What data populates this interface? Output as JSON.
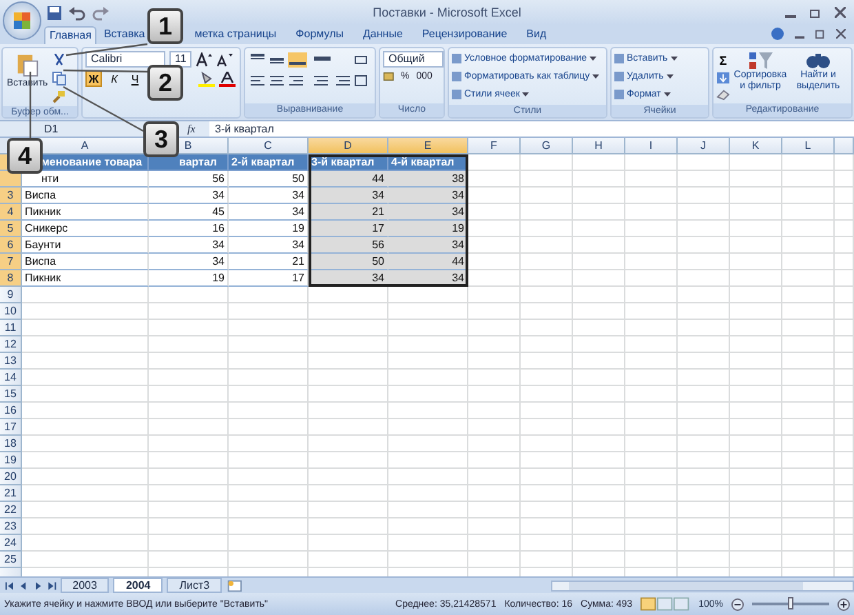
{
  "window": {
    "title": "Поставки - Microsoft Excel"
  },
  "tabs": [
    {
      "label": "Главная",
      "selected": true
    },
    {
      "label": "Вставка",
      "selected": false
    },
    {
      "label": "метка страницы",
      "selected": false
    },
    {
      "label": "Формулы",
      "selected": false
    },
    {
      "label": "Данные",
      "selected": false
    },
    {
      "label": "Рецензирование",
      "selected": false
    },
    {
      "label": "Вид",
      "selected": false
    }
  ],
  "ribbon": {
    "clipboard": {
      "paste": "Вставить",
      "label": "Буфер обм..."
    },
    "font": {
      "name": "Calibri",
      "size": "11",
      "bold": "Ж",
      "italic": "К",
      "underline": "Ч"
    },
    "alignment": {
      "label": "Выравнивание"
    },
    "number": {
      "format": "Общий",
      "percent": "%",
      "thousands": "000",
      "label": "Число"
    },
    "styles": {
      "items": [
        "Условное форматирование",
        "Форматировать как таблицу",
        "Стили ячеек"
      ],
      "label": "Стили"
    },
    "cells": {
      "items": [
        "Вставить",
        "Удалить",
        "Формат"
      ],
      "label": "Ячейки"
    },
    "editing": {
      "sum": "Σ",
      "sort": "Сортировка и фильтр",
      "find": "Найти и выделить",
      "label": "Редактирование"
    }
  },
  "formula_bar": {
    "name_box": "D1",
    "function": "fx",
    "value": "3-й квартал"
  },
  "columns": [
    {
      "label": "A",
      "selected": false
    },
    {
      "label": "B",
      "selected": false
    },
    {
      "label": "C",
      "selected": false
    },
    {
      "label": "D",
      "selected": true
    },
    {
      "label": "E",
      "selected": true
    },
    {
      "label": "F",
      "selected": false
    },
    {
      "label": "G",
      "selected": false
    },
    {
      "label": "H",
      "selected": false
    },
    {
      "label": "I",
      "selected": false
    },
    {
      "label": "J",
      "selected": false
    },
    {
      "label": "K",
      "selected": false
    },
    {
      "label": "L",
      "selected": false
    }
  ],
  "rows": [
    {
      "kind": "header",
      "selected": true,
      "cells": [
        "менование товара",
        "вартал",
        "2-й квартал",
        "3-й квартал",
        "4-й квартал"
      ]
    },
    {
      "kind": "data",
      "selected": true,
      "cells": [
        "нти",
        "56",
        "50",
        "44",
        "38"
      ]
    },
    {
      "kind": "data",
      "num": "3",
      "selected": true,
      "cells": [
        "Виспа",
        "34",
        "34",
        "34",
        "34"
      ]
    },
    {
      "kind": "data",
      "num": "4",
      "selected": true,
      "cells": [
        "Пикник",
        "45",
        "34",
        "21",
        "34"
      ]
    },
    {
      "kind": "data",
      "num": "5",
      "selected": true,
      "cells": [
        "Сникерс",
        "16",
        "19",
        "17",
        "19"
      ]
    },
    {
      "kind": "data",
      "num": "6",
      "selected": true,
      "cells": [
        "Баунти",
        "34",
        "34",
        "56",
        "34"
      ]
    },
    {
      "kind": "data",
      "num": "7",
      "selected": true,
      "cells": [
        "Виспа",
        "34",
        "21",
        "50",
        "44"
      ]
    },
    {
      "kind": "data",
      "num": "8",
      "selected": true,
      "cells": [
        "Пикник",
        "19",
        "17",
        "34",
        "34"
      ]
    },
    {
      "kind": "empty",
      "num": "9",
      "selected": false
    },
    {
      "kind": "empty",
      "num": "10",
      "selected": false
    },
    {
      "kind": "empty",
      "num": "11",
      "selected": false
    },
    {
      "kind": "empty",
      "num": "12",
      "selected": false
    },
    {
      "kind": "empty",
      "num": "13",
      "selected": false
    },
    {
      "kind": "empty",
      "num": "14",
      "selected": false
    },
    {
      "kind": "empty",
      "num": "15",
      "selected": false
    },
    {
      "kind": "empty",
      "num": "16",
      "selected": false
    },
    {
      "kind": "empty",
      "num": "17",
      "selected": false
    },
    {
      "kind": "empty",
      "num": "18",
      "selected": false
    },
    {
      "kind": "empty",
      "num": "19",
      "selected": false
    },
    {
      "kind": "empty",
      "num": "20",
      "selected": false
    },
    {
      "kind": "empty",
      "num": "21",
      "selected": false
    },
    {
      "kind": "empty",
      "num": "22",
      "selected": false
    },
    {
      "kind": "empty",
      "num": "23",
      "selected": false
    },
    {
      "kind": "empty",
      "num": "24",
      "selected": false
    },
    {
      "kind": "empty",
      "num": "25",
      "selected": false
    },
    {
      "kind": "empty",
      "selected": false
    }
  ],
  "sheets": [
    {
      "label": "2003",
      "selected": false
    },
    {
      "label": "2004",
      "selected": true
    },
    {
      "label": "Лист3",
      "selected": false
    }
  ],
  "status_bar": {
    "message": "Укажите ячейку и нажмите ВВОД или выберите \"Вставить\"",
    "average": "Среднее: 35,21428571",
    "count": "Количество: 16",
    "sum": "Сумма: 493",
    "zoom": "100%",
    "zoom_level": {
      "level": 0.5
    }
  },
  "callouts": [
    {
      "label": "1"
    },
    {
      "label": "2"
    },
    {
      "label": "3"
    },
    {
      "label": "4"
    }
  ]
}
